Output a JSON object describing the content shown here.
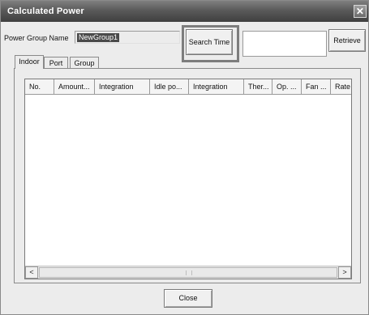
{
  "window": {
    "title": "Calculated Power",
    "close_glyph": "✕"
  },
  "power_group": {
    "label": "Power Group Name",
    "value": "NewGroup1"
  },
  "buttons": {
    "search_time": "Search Time",
    "retrieve": "Retrieve",
    "close": "Close"
  },
  "tabs": [
    {
      "label": "Indoor",
      "active": true
    },
    {
      "label": "Port",
      "active": false
    },
    {
      "label": "Group",
      "active": false
    }
  ],
  "table": {
    "columns": [
      "No.",
      "Amount...",
      "Integration",
      "Idle po...",
      "Integration",
      "Ther...",
      "Op. ...",
      "Fan ...",
      "Rate"
    ],
    "rows": []
  },
  "scrollbar": {
    "left_arrow": "<",
    "right_arrow": ">"
  },
  "colors": {
    "titlebar": "#5a5a5a",
    "highlight_frame": "#7d7d7d",
    "selected_text_bg": "#4a4a4a"
  }
}
